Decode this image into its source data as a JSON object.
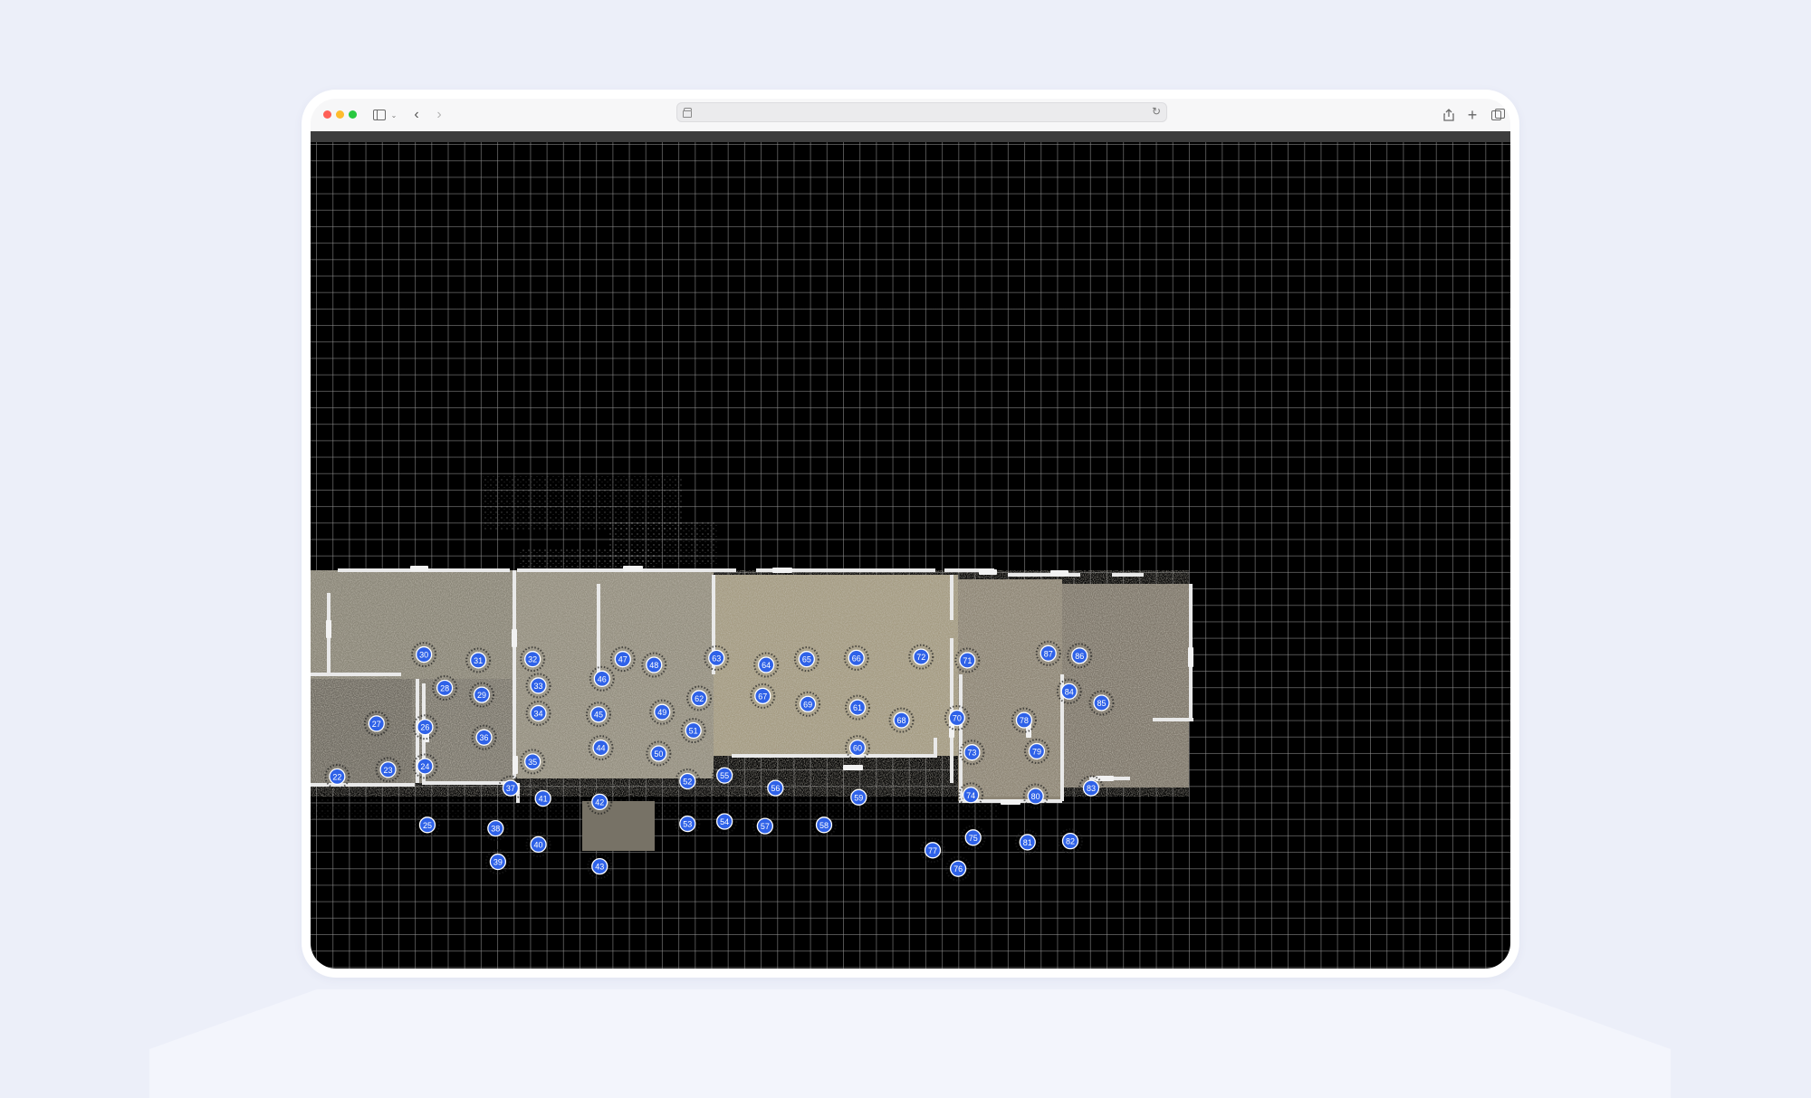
{
  "browser": {
    "address": "",
    "icons": {
      "sidebar": "sidebar-icon",
      "back": "chevron-left-icon",
      "forward": "chevron-right-icon",
      "reload": "reload-icon",
      "share": "share-icon",
      "new_tab": "plus-icon",
      "tabs": "tabs-overview-icon"
    }
  },
  "viewer": {
    "background": "#000000",
    "grid_color": "#969696",
    "marker_color": "#2f62e8",
    "scan_points": [
      "22",
      "23",
      "24",
      "25",
      "26",
      "27",
      "28",
      "29",
      "30",
      "31",
      "32",
      "33",
      "34",
      "35",
      "36",
      "37",
      "38",
      "39",
      "40",
      "41",
      "42",
      "43",
      "44",
      "45",
      "46",
      "47",
      "48",
      "49",
      "50",
      "51",
      "52",
      "53",
      "54",
      "55",
      "56",
      "57",
      "58",
      "59",
      "60",
      "61",
      "62",
      "63",
      "64",
      "65",
      "66",
      "67",
      "68",
      "69",
      "70",
      "71",
      "72",
      "73",
      "74",
      "75",
      "76",
      "77",
      "78",
      "79",
      "80",
      "81",
      "82",
      "83",
      "84",
      "85",
      "86",
      "87"
    ]
  }
}
